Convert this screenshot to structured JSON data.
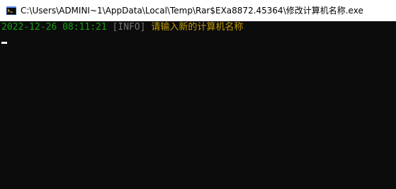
{
  "window": {
    "title": "C:\\Users\\ADMINI~1\\AppData\\Local\\Temp\\Rar$EXa8872.45364\\修改计算机名称.exe",
    "icon": "console-app-icon"
  },
  "console": {
    "lines": [
      {
        "timestamp": "2022-12-26 08:11:21",
        "level": "[INFO]",
        "message": "请输入新的计算机名称"
      }
    ]
  },
  "colors": {
    "background": "#0c0c0c",
    "timestamp": "#13a10e",
    "level": "#767676",
    "message": "#c19c00",
    "cursor": "#f2f2f2"
  }
}
